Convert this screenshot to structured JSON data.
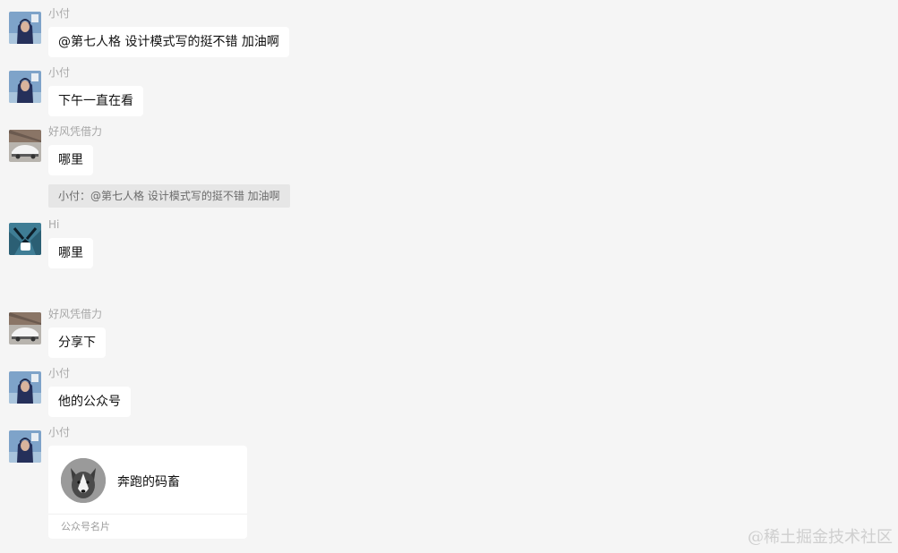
{
  "messages": [
    {
      "sender": "小付",
      "text": "@第七人格 设计模式写的挺不错 加油啊",
      "avatar": "person-in-hood-avatar"
    },
    {
      "sender": "小付",
      "text": "下午一直在看",
      "avatar": "person-in-hood-avatar"
    },
    {
      "sender": "好风凭借力",
      "text": "哪里",
      "avatar": "white-car-avatar",
      "quote": "小付：@第七人格 设计模式写的挺不错 加油啊"
    },
    {
      "sender": "Hi",
      "text": "哪里",
      "avatar": "cartoon-cat-avatar"
    },
    {
      "sender": "好风凭借力",
      "text": "分享下",
      "avatar": "white-car-avatar"
    },
    {
      "sender": "小付",
      "text": "他的公众号",
      "avatar": "person-in-hood-avatar"
    },
    {
      "sender": "小付",
      "avatar": "person-in-hood-avatar",
      "card": {
        "name": "奔跑的码畜",
        "footer": "公众号名片",
        "avatar": "husky-dog-avatar"
      }
    }
  ],
  "watermark": "@稀土掘金技术社区",
  "colors": {
    "background": "#f5f5f5",
    "bubble": "#ffffff",
    "quote_bg": "#e6e6e6",
    "sender_text": "#a8a8a8"
  }
}
